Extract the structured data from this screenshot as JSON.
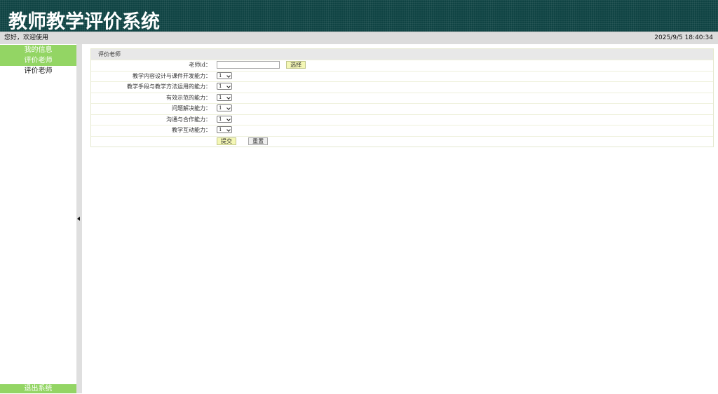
{
  "header": {
    "title": "教师教学评价系统"
  },
  "status": {
    "welcome": "您好，欢迎使用",
    "datetime": "2025/9/5 18:40:34"
  },
  "sidebar": {
    "items": [
      {
        "label": "我的信息"
      },
      {
        "label": "评价老师"
      },
      {
        "label": "评价老师"
      }
    ],
    "exit_label": "退出系统"
  },
  "form": {
    "title": "评价老师",
    "teacher_id_label": "老师id：",
    "teacher_id_value": "",
    "choose_label": "选择",
    "criteria": [
      {
        "label": "教学内容设计与课件开发能力：",
        "value": "1"
      },
      {
        "label": "教学手段与教学方法运用的能力：",
        "value": "1"
      },
      {
        "label": "有效示范的能力：",
        "value": "1"
      },
      {
        "label": "问题解决能力：",
        "value": "1"
      },
      {
        "label": "沟通与合作能力：",
        "value": "1"
      },
      {
        "label": "教学互动能力：",
        "value": "1"
      }
    ],
    "submit_label": "提交",
    "reset_label": "重置"
  },
  "colors": {
    "header_bg": "#0f4343",
    "menu_green": "#93d564",
    "button_yellow": "#f4f7b5"
  }
}
